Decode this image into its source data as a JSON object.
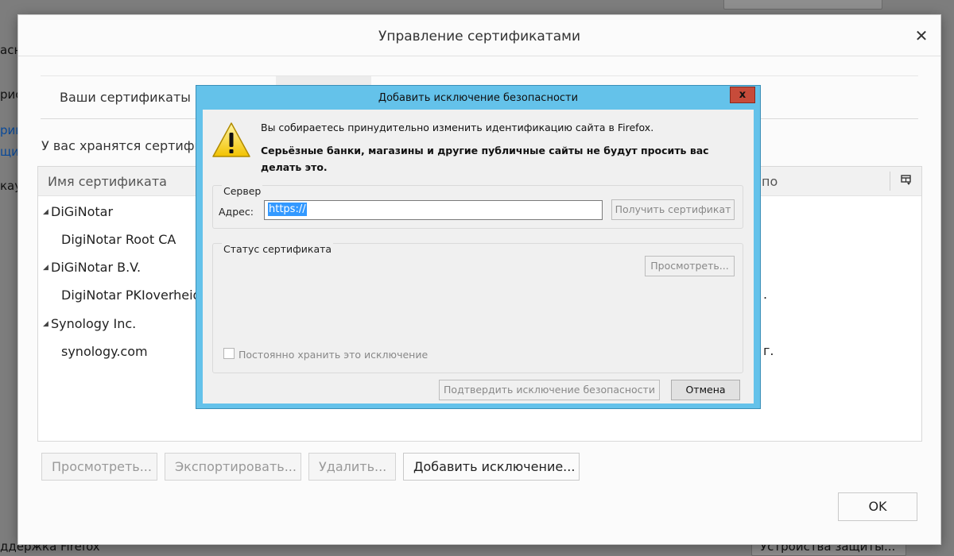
{
  "background": {
    "left_fragments": [
      "асно",
      "рис",
      "рив",
      "щи",
      "кау"
    ],
    "bottom_left": "ддержка Firefox",
    "bottom_right_button": "Устройства защиты..."
  },
  "cert_manager": {
    "title": "Управление сертификатами",
    "tabs": [
      {
        "label": "Ваши сертификаты"
      }
    ],
    "description": "У вас хранятся сертифик",
    "columns": {
      "name": "Имя сертификата",
      "right": "по"
    },
    "rows": [
      {
        "label": "DiGiNotar",
        "expanded": true
      },
      {
        "label": "DigiNotar Root CA",
        "extra": ""
      },
      {
        "label": "DiGiNotar B.V.",
        "expanded": true
      },
      {
        "label": "DigiNotar PKIoverheid",
        "extra": "."
      },
      {
        "label": "Synology Inc.",
        "expanded": true
      },
      {
        "label": "synology.com",
        "extra": "г."
      }
    ],
    "buttons": {
      "view": "Просмотреть...",
      "export": "Экспортировать...",
      "delete": "Удалить...",
      "add_exception": "Добавить исключение..."
    },
    "ok": "OK"
  },
  "exception_dialog": {
    "title": "Добавить исключение безопасности",
    "warning_line1": "Вы собираетесь принудительно изменить идентификацию сайта в Firefox.",
    "warning_line2": "Серьёзные банки, магазины и другие публичные сайты не будут просить вас делать это.",
    "server_group": "Сервер",
    "address_label": "Адрес:",
    "address_value": "https://",
    "get_cert_button": "Получить сертификат",
    "status_group": "Статус сертификата",
    "view_button": "Просмотреть...",
    "permanent_checkbox": "Постоянно хранить это исключение",
    "confirm_button": "Подтвердить исключение безопасности",
    "cancel_button": "Отмена",
    "close_glyph": "x"
  },
  "colors": {
    "titlebar": "#64c2ea",
    "close_button": "#c74b3a",
    "selection": "#3399ff"
  },
  "icons": [
    "warning-icon",
    "close-icon",
    "column-picker-icon",
    "twisty-icon"
  ]
}
